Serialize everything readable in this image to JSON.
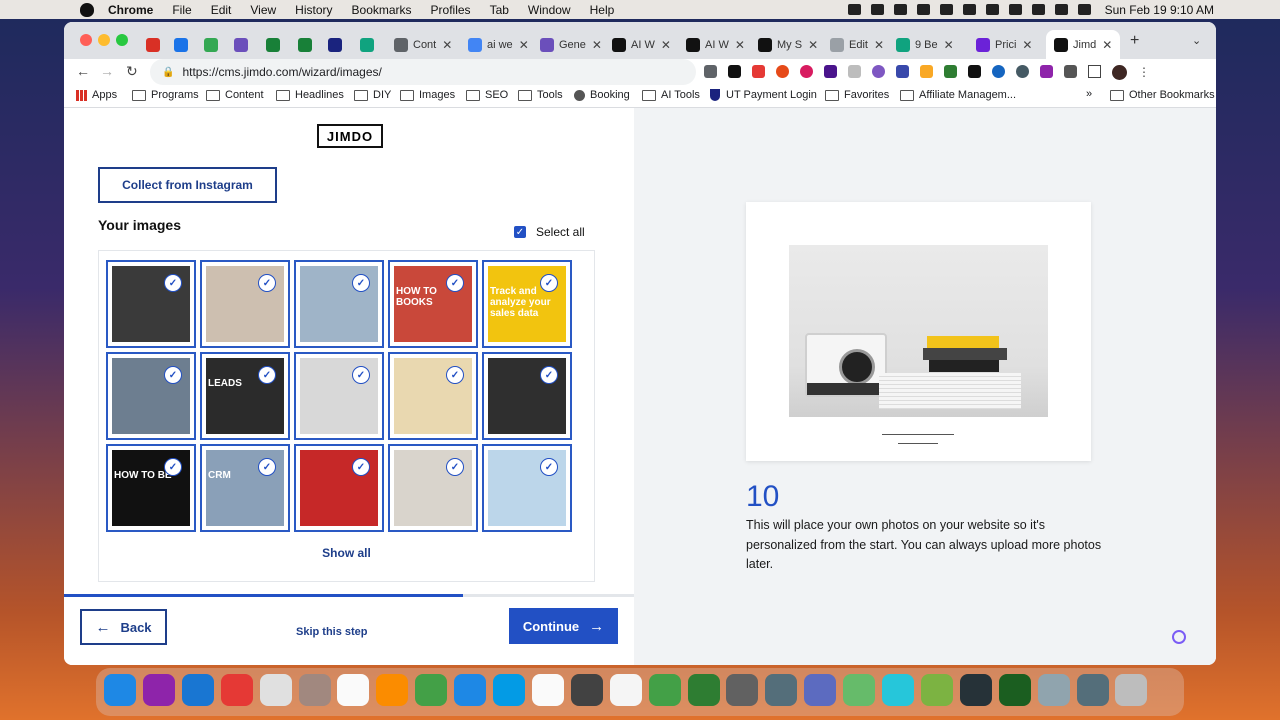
{
  "menubar": {
    "app": "Chrome",
    "items": [
      "File",
      "Edit",
      "View",
      "History",
      "Bookmarks",
      "Profiles",
      "Tab",
      "Window",
      "Help"
    ],
    "clock": "Sun Feb 19  9:10 AM"
  },
  "tabs": [
    {
      "label": "",
      "color": "#d93025"
    },
    {
      "label": "",
      "color": "#1a73e8"
    },
    {
      "label": "",
      "color": "#34a853"
    },
    {
      "label": "",
      "color": "#6b4fbb"
    },
    {
      "label": "",
      "color": "#188038"
    },
    {
      "label": "",
      "color": "#188038"
    },
    {
      "label": "",
      "color": "#1a237e"
    },
    {
      "label": "",
      "color": "#10a37f"
    },
    {
      "label": "Cont",
      "color": "#5f6368"
    },
    {
      "label": "ai we",
      "color": "#4285f4"
    },
    {
      "label": "Gene",
      "color": "#6b4fbb"
    },
    {
      "label": "AI W",
      "color": "#111111"
    },
    {
      "label": "AI W",
      "color": "#111111"
    },
    {
      "label": "My S",
      "color": "#111111"
    },
    {
      "label": "Edit",
      "color": "#9aa0a6"
    },
    {
      "label": "9 Be",
      "color": "#10a37f"
    },
    {
      "label": "Prici",
      "color": "#6b22d8"
    },
    {
      "label": "Jimd",
      "color": "#111111"
    }
  ],
  "address": {
    "url": "https://cms.jimdo.com/wizard/images/"
  },
  "bookmarks": [
    "Apps",
    "Programs",
    "Content",
    "Headlines",
    "DIY",
    "Images",
    "SEO",
    "Tools",
    "Booking",
    "AI Tools",
    "UT Payment Login",
    "Favorites",
    "Affiliate Managem...",
    "Other Bookmarks"
  ],
  "page": {
    "logo": "JIMDO",
    "instagram_button": "Collect from Instagram",
    "your_images": "Your images",
    "select_all": "Select all",
    "show_all": "Show all",
    "back": "Back",
    "skip": "Skip this step",
    "continue": "Continue",
    "progress": 0.7,
    "step_number": "10",
    "description": "This will place your own photos on your website so it's personalized from the start. You can always upload more photos later."
  },
  "images": [
    {
      "name": "tools-collage",
      "color": "#3a3a3a",
      "label": ""
    },
    {
      "name": "hand-phone",
      "color": "#cdbfb0",
      "label": ""
    },
    {
      "name": "laptop-typing",
      "color": "#9fb4c8",
      "label": ""
    },
    {
      "name": "how-to-books",
      "color": "#c9483a",
      "label": "HOW TO BOOKS"
    },
    {
      "name": "track-sales",
      "color": "#f2c40f",
      "label": "Track and analyze your sales data"
    },
    {
      "name": "ocean-text",
      "color": "#6d7e90",
      "label": ""
    },
    {
      "name": "leads-letters",
      "color": "#2b2b2b",
      "label": "LEADS"
    },
    {
      "name": "meeting",
      "color": "#d8d8d8",
      "label": ""
    },
    {
      "name": "fruit-sunglasses",
      "color": "#e9d8b0",
      "label": ""
    },
    {
      "name": "robot",
      "color": "#2f2f2f",
      "label": ""
    },
    {
      "name": "woman-book",
      "color": "#111111",
      "label": "HOW TO BE"
    },
    {
      "name": "crm",
      "color": "#8aa0b8",
      "label": "CRM"
    },
    {
      "name": "quote-circle",
      "color": "#c62828",
      "label": ""
    },
    {
      "name": "devices",
      "color": "#d9d4cc",
      "label": ""
    },
    {
      "name": "hand-sky",
      "color": "#bcd6ea",
      "label": ""
    }
  ],
  "colors": {
    "accent": "#2250c4",
    "dark_blue": "#1e3e8a"
  }
}
